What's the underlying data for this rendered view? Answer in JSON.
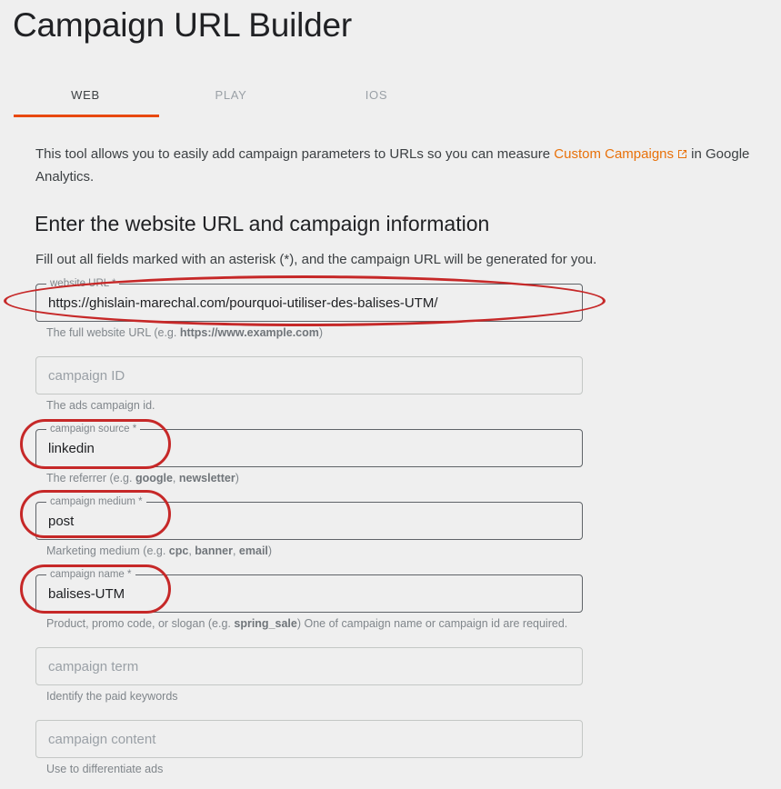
{
  "header": {
    "title": "Campaign URL Builder"
  },
  "tabs": {
    "items": [
      {
        "label": "WEB",
        "active": true
      },
      {
        "label": "PLAY",
        "active": false
      },
      {
        "label": "IOS",
        "active": false
      }
    ],
    "active_underline_color": "#e8490f"
  },
  "intro": {
    "text_before": "This tool allows you to easily add campaign parameters to URLs so you can measure ",
    "link_label": "Custom Campaigns",
    "link_icon": "external-link-icon",
    "link_color": "#e8710a",
    "text_after": " in Google Analytics."
  },
  "section": {
    "heading": "Enter the website URL and campaign information",
    "subheading": "Fill out all fields marked with an asterisk (*), and the campaign URL will be generated for you."
  },
  "fields": {
    "website_url": {
      "legend": "website URL *",
      "value": "https://ghislain-marechal.com/pourquoi-utiliser-des-balises-UTM/",
      "helper_prefix": "The full website URL (e.g. ",
      "helper_bold": "https://www.example.com",
      "helper_suffix": ")",
      "filled": true,
      "annotated": true
    },
    "campaign_id": {
      "legend": "",
      "placeholder": "campaign ID",
      "value": "",
      "helper_prefix": "The ads campaign id.",
      "helper_bold": "",
      "helper_suffix": "",
      "filled": false,
      "annotated": false
    },
    "campaign_source": {
      "legend": "campaign source *",
      "value": "linkedin",
      "helper_prefix": "The referrer (e.g. ",
      "helper_bold": "google",
      "helper_mid": ", ",
      "helper_bold2": "newsletter",
      "helper_suffix": ")",
      "filled": true,
      "annotated": true
    },
    "campaign_medium": {
      "legend": "campaign medium *",
      "value": "post",
      "helper_prefix": "Marketing medium (e.g. ",
      "helper_bold": "cpc",
      "helper_mid": ", ",
      "helper_bold2": "banner",
      "helper_mid2": ", ",
      "helper_bold3": "email",
      "helper_suffix": ")",
      "filled": true,
      "annotated": true
    },
    "campaign_name": {
      "legend": "campaign name *",
      "value": "balises-UTM",
      "helper_prefix": "Product, promo code, or slogan (e.g. ",
      "helper_bold": "spring_sale",
      "helper_suffix": ") One of campaign name or campaign id are required.",
      "filled": true,
      "annotated": true
    },
    "campaign_term": {
      "legend": "",
      "placeholder": "campaign term",
      "value": "",
      "helper_prefix": "Identify the paid keywords",
      "helper_bold": "",
      "helper_suffix": "",
      "filled": false,
      "annotated": false
    },
    "campaign_content": {
      "legend": "",
      "placeholder": "campaign content",
      "value": "",
      "helper_prefix": "Use to differentiate ads",
      "helper_bold": "",
      "helper_suffix": "",
      "filled": false,
      "annotated": false
    }
  },
  "annotations": {
    "color": "#c62828",
    "shapes": [
      {
        "name": "website-url-highlight",
        "shape": "ellipse"
      },
      {
        "name": "campaign-source-highlight",
        "shape": "pill"
      },
      {
        "name": "campaign-medium-highlight",
        "shape": "pill"
      },
      {
        "name": "campaign-name-highlight",
        "shape": "pill"
      }
    ]
  }
}
